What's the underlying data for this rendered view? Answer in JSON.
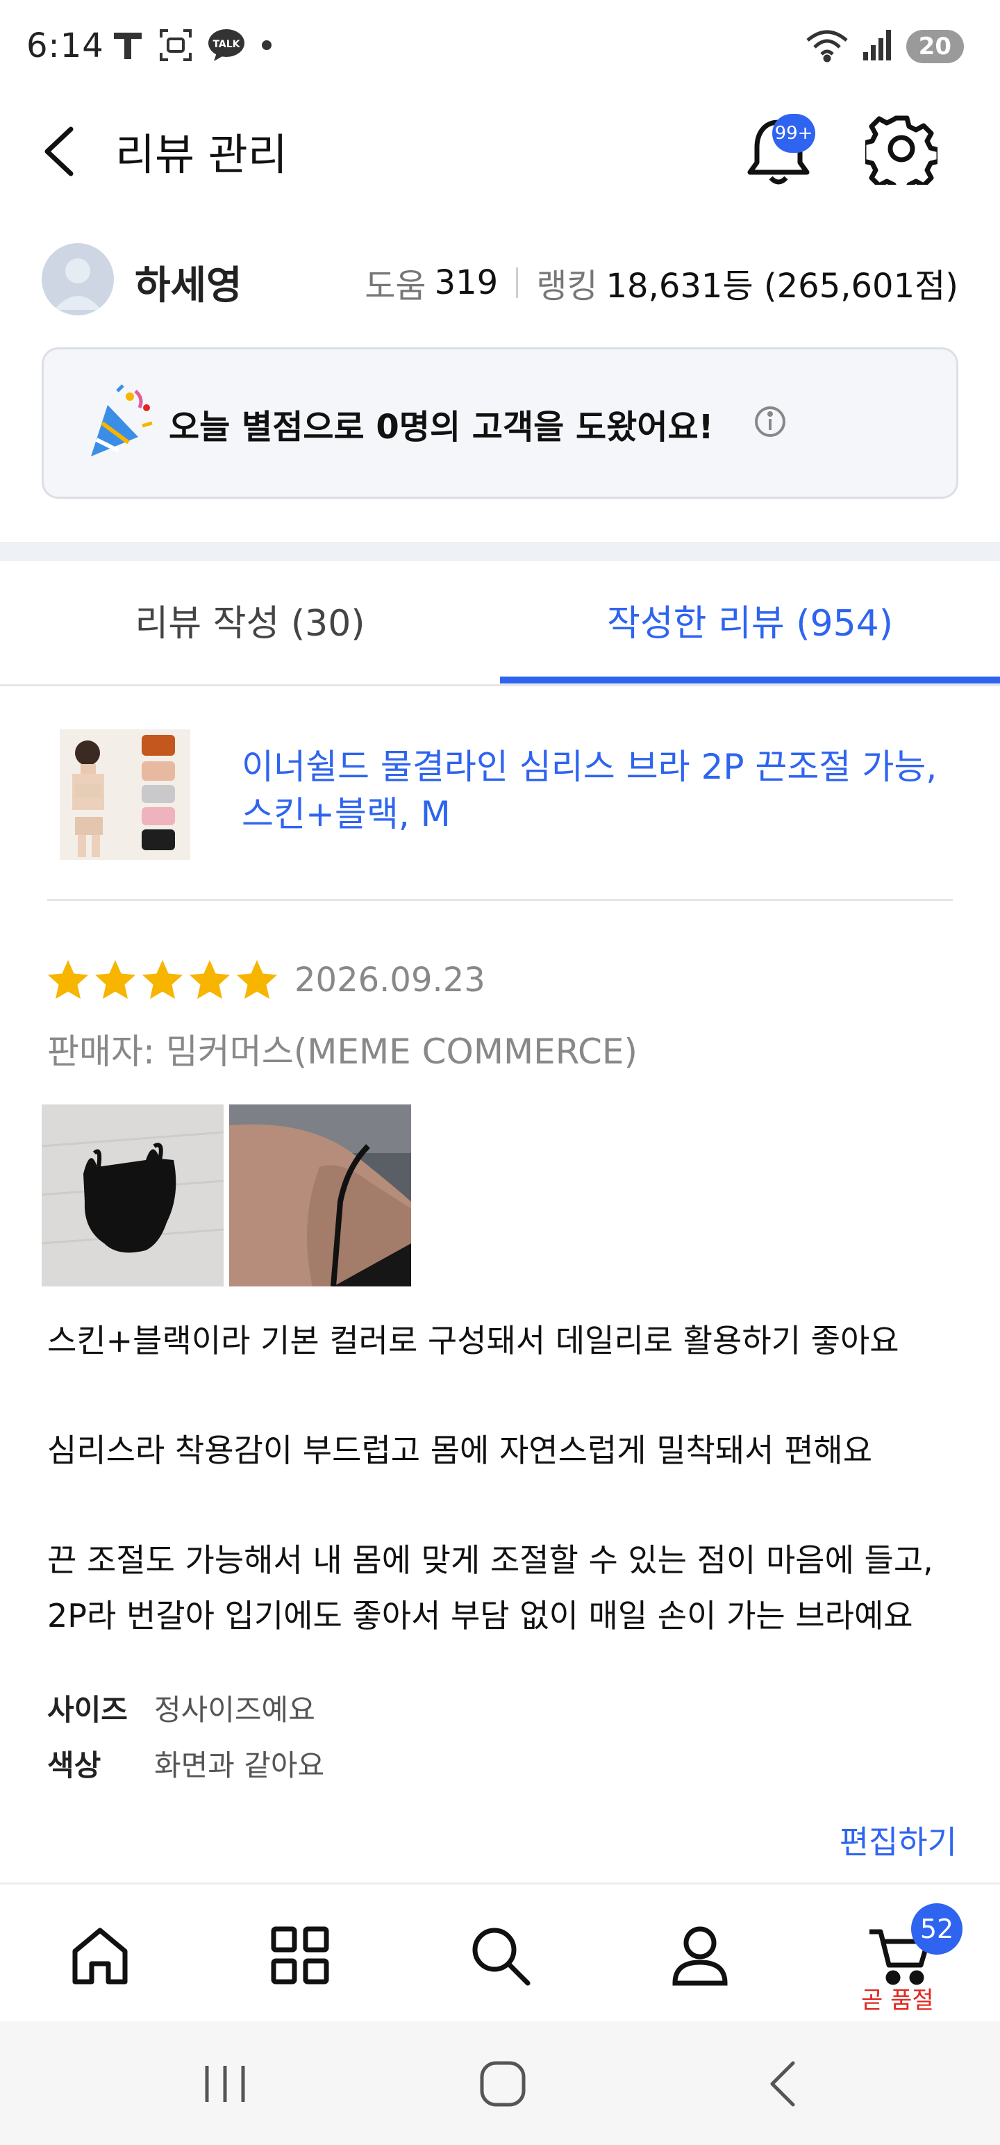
{
  "status_bar": {
    "time": "6:14",
    "talk_label": "TALK",
    "battery": "20"
  },
  "header": {
    "title": "리뷰 관리",
    "notification_badge": "99+"
  },
  "profile": {
    "name": "하세영",
    "help_label": "도움",
    "help_count": "319",
    "ranking_label": "랭킹",
    "ranking_value": "18,631등 (265,601점)"
  },
  "help_banner": {
    "text": "오늘 별점으로 0명의 고객을 도왔어요!"
  },
  "tabs": [
    {
      "label": "리뷰 작성 (30)",
      "active": false
    },
    {
      "label": "작성한 리뷰 (954)",
      "active": true
    }
  ],
  "review": {
    "product_name": "이너쉴드 물결라인 심리스 브라 2P 끈조절 가능, 스킨+블랙, M",
    "rating": 5,
    "date": "2026.09.23",
    "seller": "판매자: 밈커머스(MEME COMMERCE)",
    "body": [
      "스킨+블랙이라 기본 컬러로 구성돼서 데일리로 활용하기 좋아요",
      "심리스라 착용감이 부드럽고 몸에 자연스럽게 밀착돼서 편해요",
      "끈 조절도 가능해서 내 몸에 맞게 조절할 수 있는 점이 마음에 들고,",
      "2P라 번갈아 입기에도 좋아서 부담 없이 매일 손이 가는 브라예요"
    ],
    "attributes": [
      {
        "key": "사이즈",
        "value": "정사이즈예요"
      },
      {
        "key": "색상",
        "value": "화면과 같아요"
      }
    ],
    "edit_label": "편집하기"
  },
  "bottom_nav": {
    "items": [
      "home-icon",
      "category-icon",
      "search-icon",
      "user-icon",
      "cart-icon"
    ],
    "cart_badge": "52",
    "cart_note": "곧 품절"
  },
  "colors": {
    "accent": "#2e64f0",
    "star": "#f7b500",
    "soldout": "#e0261f"
  }
}
